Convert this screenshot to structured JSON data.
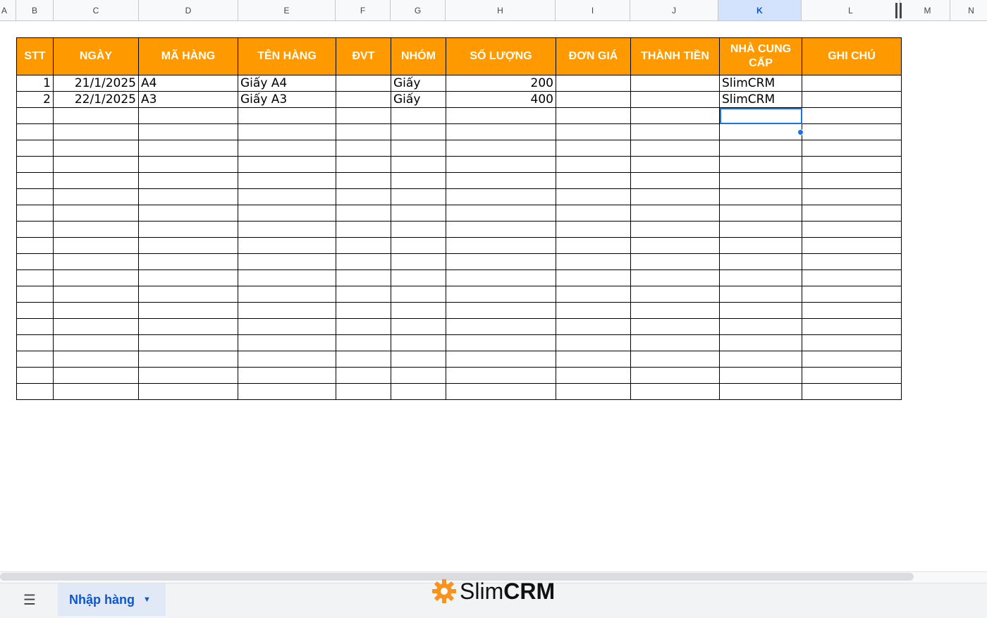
{
  "column_headers": [
    "A",
    "B",
    "C",
    "D",
    "E",
    "F",
    "G",
    "H",
    "I",
    "J",
    "K",
    "L",
    "M",
    "N"
  ],
  "selected_column": "K",
  "table": {
    "headers": [
      "STT",
      "NGÀY",
      "MÃ HÀNG",
      "TÊN HÀNG",
      "ĐVT",
      "NHÓM",
      "SỐ LƯỢNG",
      "ĐƠN GIÁ",
      "THÀNH TIỀN",
      "NHÀ CUNG CẤP",
      "GHI CHÚ"
    ],
    "rows": [
      [
        "1",
        "21/1/2025",
        "A4",
        "Giấy A4",
        "",
        "Giấy",
        "200",
        "",
        "",
        "SlimCRM",
        ""
      ],
      [
        "2",
        "22/1/2025",
        "A3",
        "Giấy A3",
        "",
        "Giấy",
        "400",
        "",
        "",
        "SlimCRM",
        ""
      ]
    ],
    "empty_rows": 18
  },
  "bottom": {
    "menu_icon": "hamburger-menu-icon",
    "sheet_tab": "Nhập hàng",
    "tab_caret_icon": "caret-down-icon"
  },
  "logo": {
    "icon": "gear-icon",
    "text_light": "Slim",
    "text_bold": "CRM",
    "color": "#f7931e"
  },
  "colors": {
    "header_fill": "#ff9900",
    "selection": "#1a73e8"
  }
}
